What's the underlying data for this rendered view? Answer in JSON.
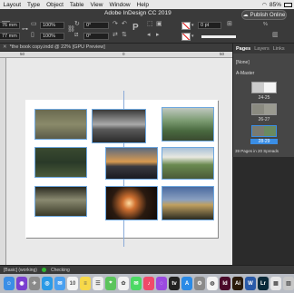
{
  "menubar": {
    "items": [
      "Layout",
      "Type",
      "Object",
      "Table",
      "View",
      "Window",
      "Help"
    ],
    "app_title": "Adobe InDesign CC 2019",
    "battery": "85%"
  },
  "control": {
    "x_value": "76 mm",
    "y_value": "77 mm",
    "scale_x": "100%",
    "scale_y": "100%",
    "rotate": "0°",
    "shear": "0°",
    "stroke_weight": "0 pt",
    "publish_label": "Publish Online"
  },
  "tab": {
    "label": "*the book copy.indd @ 22% [GPU Preview]"
  },
  "ruler": {
    "marks": [
      "50",
      "0",
      "50"
    ]
  },
  "panel": {
    "tabs": [
      "Pages",
      "Layers",
      "Links"
    ],
    "none_label": "[None]",
    "master_label": "A-Master",
    "spreads": [
      {
        "label": "24-25"
      },
      {
        "label": "26-27"
      },
      {
        "label": "28-29"
      }
    ],
    "footer": "39 Pages in 20 Spreads"
  },
  "status": {
    "style": "[Basic] (working)",
    "preflight": "Checking"
  },
  "dock": {
    "apps": [
      {
        "name": "finder-icon",
        "color": "#3a8ee6",
        "glyph": "☺"
      },
      {
        "name": "siri-icon",
        "color": "#7a3fd0",
        "glyph": "◉"
      },
      {
        "name": "launchpad-icon",
        "color": "#8a8a8a",
        "glyph": "✈"
      },
      {
        "name": "safari-icon",
        "color": "#2a9ae6",
        "glyph": "◎"
      },
      {
        "name": "mail-icon",
        "color": "#4aa0f0",
        "glyph": "✉"
      },
      {
        "name": "calendar-icon",
        "color": "#f4f4f4",
        "glyph": "10"
      },
      {
        "name": "notes-icon",
        "color": "#f7d84a",
        "glyph": "≡"
      },
      {
        "name": "reminders-icon",
        "color": "#eeeeee",
        "glyph": "☰"
      },
      {
        "name": "maps-icon",
        "color": "#5cc45c",
        "glyph": "⌖"
      },
      {
        "name": "photos-icon",
        "color": "#f2f2f2",
        "glyph": "✿"
      },
      {
        "name": "messages-icon",
        "color": "#4cd964",
        "glyph": "✉"
      },
      {
        "name": "music-icon",
        "color": "#f04a6a",
        "glyph": "♪"
      },
      {
        "name": "podcasts-icon",
        "color": "#9b4ae0",
        "glyph": "◌"
      },
      {
        "name": "tv-icon",
        "color": "#222222",
        "glyph": "tv"
      },
      {
        "name": "appstore-icon",
        "color": "#2a8ae6",
        "glyph": "A"
      },
      {
        "name": "settings-icon",
        "color": "#8a8a8a",
        "glyph": "⚙"
      },
      {
        "name": "chrome-icon",
        "color": "#f4f4f4",
        "glyph": "◍"
      },
      {
        "name": "indesign-icon",
        "color": "#4a0a2a",
        "glyph": "Id"
      },
      {
        "name": "illustrator-icon",
        "color": "#2a1a0a",
        "glyph": "Ai"
      },
      {
        "name": "word-icon",
        "color": "#2a5aa8",
        "glyph": "W"
      },
      {
        "name": "lightroom-icon",
        "color": "#0a2a3a",
        "glyph": "Lr"
      },
      {
        "name": "preview-icon",
        "color": "#e8e8e8",
        "glyph": "▦"
      },
      {
        "name": "trash-icon",
        "color": "#c8c8c8",
        "glyph": "▥"
      }
    ]
  }
}
